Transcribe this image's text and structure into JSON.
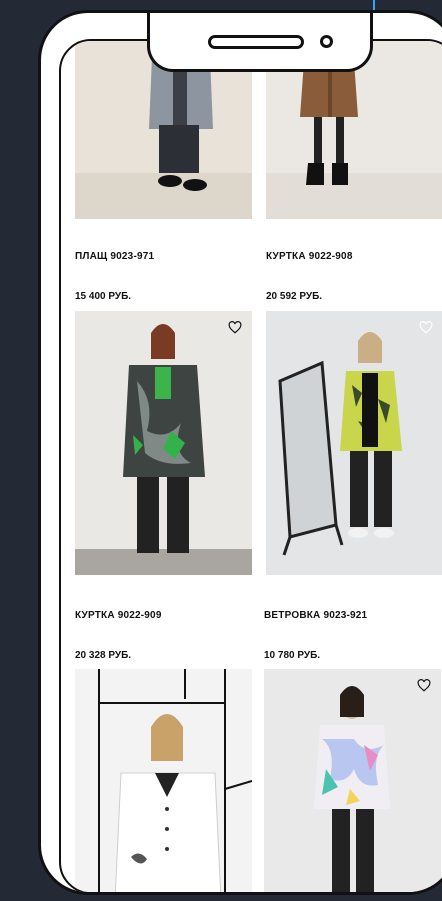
{
  "products": [
    {
      "name": "ПЛАЩ 9023-971",
      "price": "15 400 РУБ."
    },
    {
      "name": "КУРТКА 9022-908",
      "price": "20 592 РУБ."
    },
    {
      "name": "КУРТКА 9022-909",
      "price": "20 328 РУБ."
    },
    {
      "name": "ВЕТРОВКА 9023-921",
      "price": "10 780 РУБ."
    },
    {
      "name": "",
      "price": ""
    },
    {
      "name": "",
      "price": ""
    }
  ],
  "colors": {
    "background": "#232a35",
    "accent": "#3aa0ff",
    "frame": "#111111"
  },
  "icons": {
    "favorite": "heart-outline-icon"
  }
}
